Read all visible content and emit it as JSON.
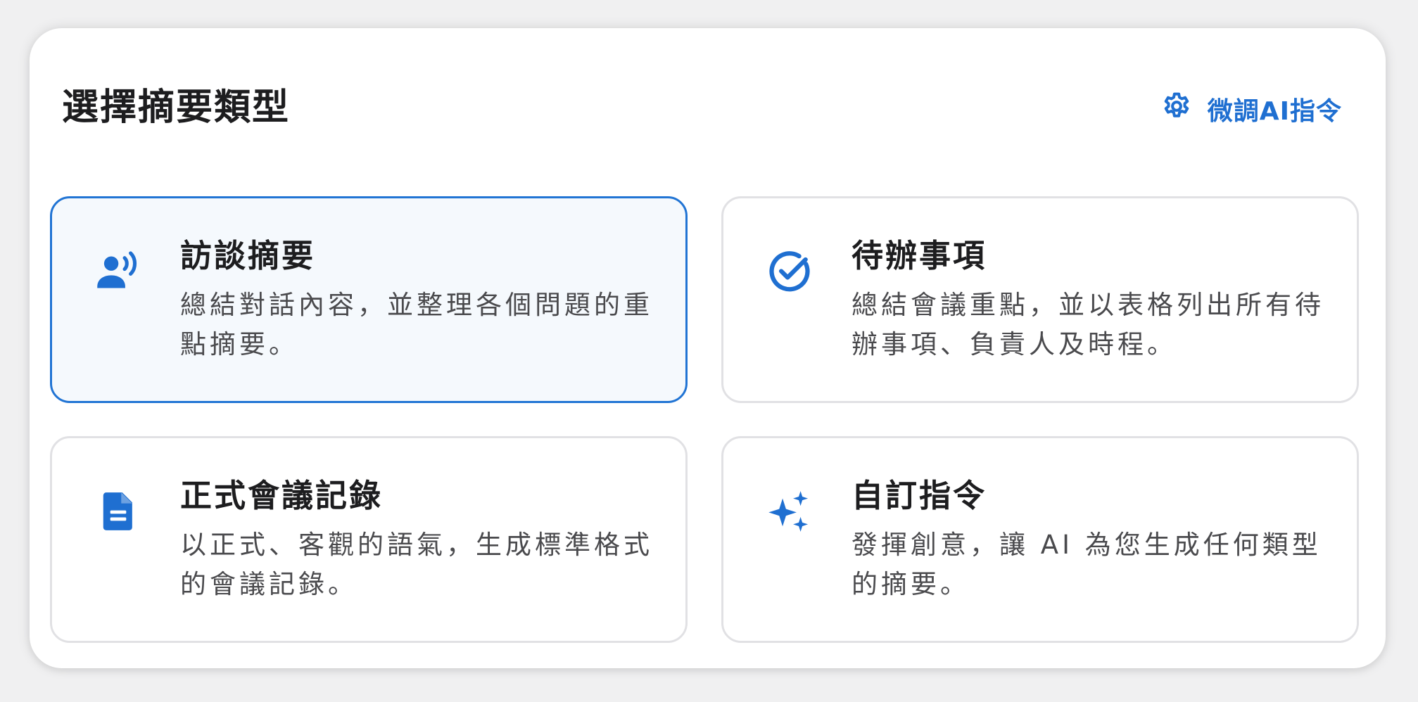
{
  "header": {
    "title": "選擇摘要類型",
    "tune_link_label": "微調AI指令",
    "tune_link_icon": "gear-icon"
  },
  "colors": {
    "accent": "#2174d4",
    "selected_bg": "#f5f9fd",
    "card_border": "#e1e1e4",
    "title_text": "#1d1d1f",
    "desc_text": "#4a4a4d"
  },
  "cards": [
    {
      "id": "interview",
      "icon": "speaking-person-icon",
      "title": "訪談摘要",
      "description": "總結對話內容，並整理各個問題的重點摘要。",
      "selected": true
    },
    {
      "id": "todo",
      "icon": "check-circle-icon",
      "title": "待辦事項",
      "description": "總結會議重點，並以表格列出所有待辦事項、負責人及時程。",
      "selected": false
    },
    {
      "id": "minutes",
      "icon": "document-icon",
      "title": "正式會議記錄",
      "description": "以正式、客觀的語氣，生成標準格式的會議記錄。",
      "selected": false
    },
    {
      "id": "custom",
      "icon": "sparkle-icon",
      "title": "自訂指令",
      "description": "發揮創意，讓 AI 為您生成任何類型的摘要。",
      "selected": false
    }
  ]
}
